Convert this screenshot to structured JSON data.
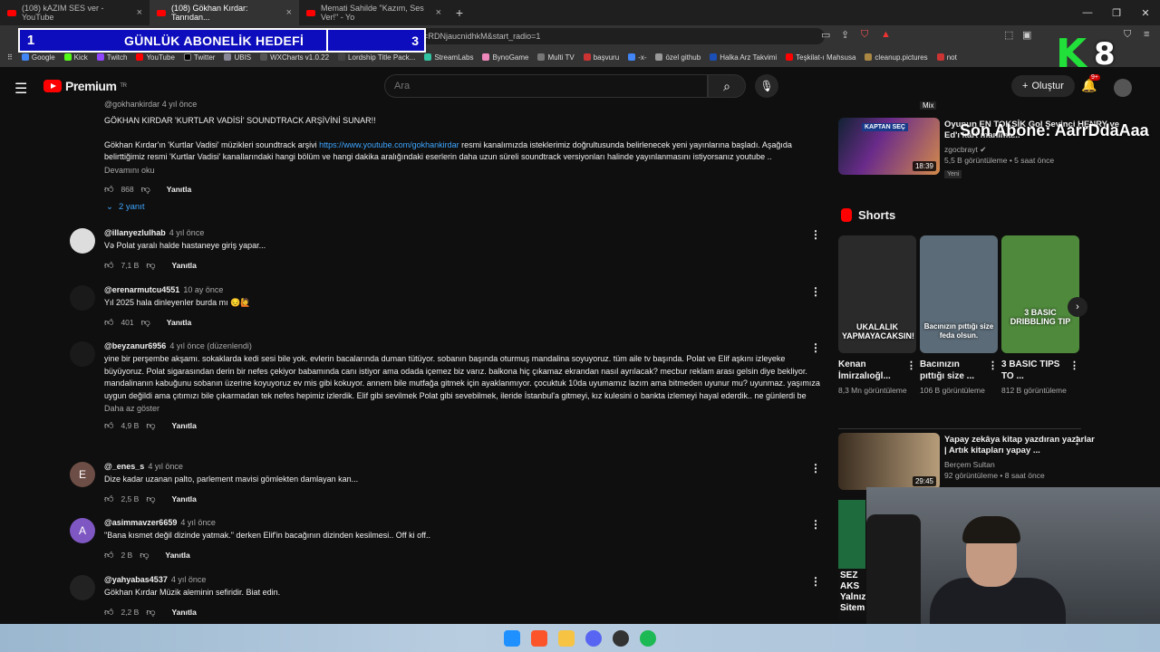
{
  "browser": {
    "tabs": [
      {
        "label": "(108) kAZIM SES ver - YouTube",
        "active": false
      },
      {
        "label": "(108) Gökhan Kırdar: Tanrıdan...",
        "active": true
      },
      {
        "label": "Memati Sahilde \"Kazım, Ses Ver!\" - Yo",
        "active": false
      }
    ],
    "url": "watch?v=NjaucnidhkM&list=RDNjaucnidhkM&start_radio=1",
    "bookmarks": [
      "Google",
      "Kick",
      "Twitch",
      "YouTube",
      "Twitter",
      "UBIS",
      "WXCharts v1.0.22",
      "Lordship Title Pack...",
      "StreamLabs",
      "BynoGame",
      "Multi TV",
      "başvuru",
      "-x-",
      "özel github",
      "Halka Arz Takvimi",
      "Teşkilat-ı Mahsusa",
      "cleanup.pictures",
      "not"
    ]
  },
  "overlay": {
    "goal_left": "1",
    "goal_title": "GÜNLÜK ABONELİK HEDEFİ",
    "goal_right": "3",
    "k_letter": "K",
    "k_number": "8",
    "son_abone": "Son Abone: AarrDdaAaa"
  },
  "youtube": {
    "logo_text": "Premium",
    "logo_sup": "TR",
    "search_placeholder": "Ara",
    "create_label": "Oluştur",
    "notif_count": "9+"
  },
  "comments": {
    "pinned_author_partial": "@gokhankirdar",
    "pinned_time": "4 yıl önce",
    "pinned_line1": "GÖKHAN KIRDAR 'KURTLAR VADİSİ' SOUNDTRACK ARŞİVİNİ SUNAR!!",
    "pinned_line2_pre": "Gökhan Kırdar'ın 'Kurtlar Vadisi' müzikleri soundtrack arşivi ",
    "pinned_link": "https://www.youtube.com/gokhankirdar",
    "pinned_line2_post": " resmi kanalımızda isteklerimiz doğrultusunda belirlenecek yeni yayınlarına başladı. Aşağıda belirttiğimiz resmi 'Kurtlar Vadisi' kanallarındaki hangi bölüm ve hangi dakika aralığındaki eserlerin daha uzun süreli soundtrack versiyonları halinde yayınlanmasını istiyorsanız youtube ..",
    "pinned_more": "Devamını oku",
    "pinned_likes": "868",
    "reply_label": "Yanıtla",
    "pinned_replies": "2 yanıt",
    "items": [
      {
        "author": "@illanyezlulhab",
        "time": "4 yıl önce",
        "text": "Və Polat yaralı halde hastaneye giriş yapar...",
        "likes": "7,1 B",
        "avatar": ""
      },
      {
        "author": "@erenarmutcu4551",
        "time": "10 ay önce",
        "text": "Yıl 2025 hala dinleyenler burda mı 😔🙋",
        "likes": "401",
        "avatar": ""
      },
      {
        "author": "@beyzanur6956",
        "time": "4 yıl önce (düzenlendi)",
        "text": "yine bir perşembe akşamı. sokaklarda kedi sesi bile yok. evlerin bacalarında duman tütüyor. sobanın başında oturmuş mandalina soyuyoruz. tüm aile tv başında. Polat ve Elif aşkını izleyeke büyüyoruz. Polat sigarasından derin bir nefes çekiyor babamında canı istiyor ama odada içemez biz varız. balkona hiç çıkamaz ekrandan nasıl ayrılacak? mecbur reklam arası gelsin diye bekliyor. mandalinanın kabuğunu sobanın üzerine koyuyoruz ev mis gibi kokuyor. annem bile mutfağa gitmek için ayaklanmıyor. çocuktuk 10da uyumamız lazım ama bitmeden uyunur mu? uyunmaz. yaşımıza uygun değildi ama çıtımızı bile çıkarmadan tek nefes hepimiz izlerdik. Elif gibi sevilmek Polat gibi sevebilmek, ileride İstanbul'a gitmeyi, kız kulesini o bankta izlemeyi hayal ederdik.. ne günlerdi be",
        "likes": "4,9 B",
        "more": "Daha az göster",
        "avatar": ""
      },
      {
        "author": "@_enes_s",
        "time": "4 yıl önce",
        "text": "Dize kadar uzanan palto, parlement mavisi gömlekten damlayan kan...",
        "likes": "2,5 B",
        "avatar": "E"
      },
      {
        "author": "@asimmavzer6659",
        "time": "4 yıl önce",
        "text": "\"Bana kısmet değil dizinde yatmak.\" derken Elif'in bacağının dizinden kesilmesi.. Off ki off..",
        "likes": "2 B",
        "avatar": "A"
      },
      {
        "author": "@yahyabas4537",
        "time": "4 yıl önce",
        "text": "Gökhan Kırdar Müzik aleminin sefiridir. Biat edin.",
        "likes": "2,2 B",
        "avatar": ""
      }
    ]
  },
  "sidebar": {
    "top_tag": "Mix",
    "video1": {
      "thumb_text": "KAPTAN SEÇ",
      "duration": "18:39",
      "title": "Oyunun EN TOKSİK Gol Sevinci HENRY ve Ed'ı kart manima...",
      "channel": "zgocbrayt",
      "meta": "5,5 B görüntüleme • 5 saat önce",
      "badge": "Yeni"
    },
    "shorts_label": "Shorts",
    "shorts": [
      {
        "caption": "UKALALIK YAPMAYACAKSIN!",
        "title": "Kenan İmirzalıoğl...",
        "views": "8,3 Mn görüntüleme",
        "color": "#2a2a2a"
      },
      {
        "caption": "Bacınızın pıttığı size feda olsun.",
        "title": "Bacınızın pıttığı size ...",
        "views": "106 B görüntüleme",
        "color": "#5b6b77"
      },
      {
        "caption": "3 BASIC DRIBBLING TIP",
        "title": "3 BASIC TIPS TO ...",
        "views": "812 B görüntüleme",
        "color": "#4f8a3c"
      }
    ],
    "video2": {
      "duration": "29:45",
      "title": "Yapay zekâya kitap yazdıran yazarlar | Artık kitapları yapay ...",
      "channel": "Berçem Sultan",
      "meta": "92 görüntüleme • 8 saat önce"
    },
    "partial_thumb": "SEZ AKS Yalnız Sitem"
  }
}
